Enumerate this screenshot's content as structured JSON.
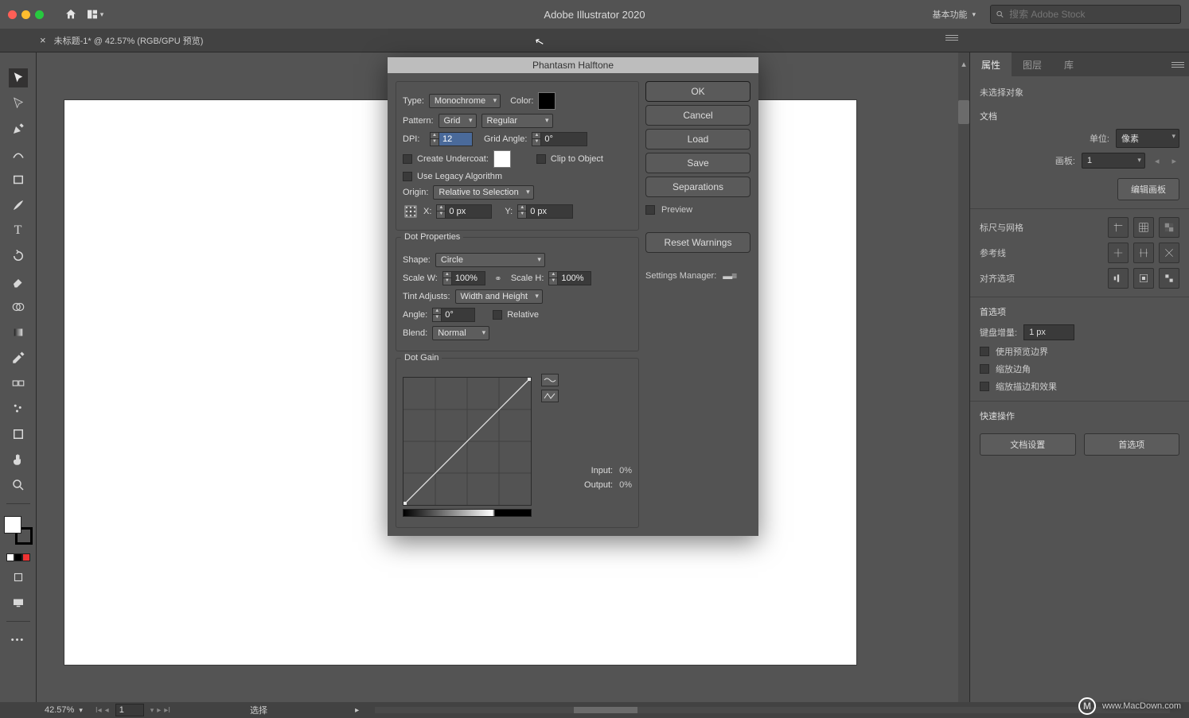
{
  "app": {
    "title": "Adobe Illustrator 2020"
  },
  "menubar": {
    "workspace": "基本功能",
    "search_placeholder": "搜索 Adobe Stock"
  },
  "doc_tab": {
    "title": "未标题-1* @ 42.57% (RGB/GPU 预览)"
  },
  "right_panel": {
    "tabs": [
      "属性",
      "图层",
      "库"
    ],
    "no_selection": "未选择对象",
    "doc_section": "文档",
    "units_label": "单位:",
    "units_value": "像素",
    "artboard_label": "画板:",
    "artboard_value": "1",
    "edit_artboards": "编辑画板",
    "rulers_grid": "标尺与网格",
    "guides": "参考线",
    "align_options": "对齐选项",
    "prefs": "首选项",
    "key_inc_label": "键盘增量:",
    "key_inc_value": "1 px",
    "use_preview_bounds": "使用预览边界",
    "scale_corners": "缩放边角",
    "scale_strokes": "缩放描边和效果",
    "quick_actions": "快速操作",
    "doc_setup": "文档设置",
    "prefs_btn": "首选项"
  },
  "status": {
    "zoom": "42.57%",
    "page": "1",
    "select_label": "选择"
  },
  "dialog": {
    "title": "Phantasm Halftone",
    "buttons": {
      "ok": "OK",
      "cancel": "Cancel",
      "load": "Load",
      "save": "Save",
      "separations": "Separations",
      "reset": "Reset Warnings"
    },
    "preview": "Preview",
    "settings_manager": "Settings Manager:",
    "type_label": "Type:",
    "type_value": "Monochrome",
    "color_label": "Color:",
    "pattern_label": "Pattern:",
    "pattern_value": "Grid",
    "pattern_mode": "Regular",
    "dpi_label": "DPI:",
    "dpi_value": "12",
    "grid_angle_label": "Grid Angle:",
    "grid_angle_value": "0°",
    "undercoat": "Create Undercoat:",
    "clip": "Clip to Object",
    "legacy": "Use Legacy Algorithm",
    "origin_label": "Origin:",
    "origin_value": "Relative to Selection",
    "x_label": "X:",
    "x_value": "0 px",
    "y_label": "Y:",
    "y_value": "0 px",
    "dot_section": "Dot Properties",
    "shape_label": "Shape:",
    "shape_value": "Circle",
    "scalew_label": "Scale W:",
    "scalew_value": "100%",
    "scaleh_label": "Scale H:",
    "scaleh_value": "100%",
    "tint_label": "Tint Adjusts:",
    "tint_value": "Width and Height",
    "angle_label": "Angle:",
    "angle_value": "0°",
    "relative": "Relative",
    "blend_label": "Blend:",
    "blend_value": "Normal",
    "gain_section": "Dot Gain",
    "input_label": "Input:",
    "input_value": "0%",
    "output_label": "Output:",
    "output_value": "0%"
  },
  "watermark": "www.MacDown.com"
}
